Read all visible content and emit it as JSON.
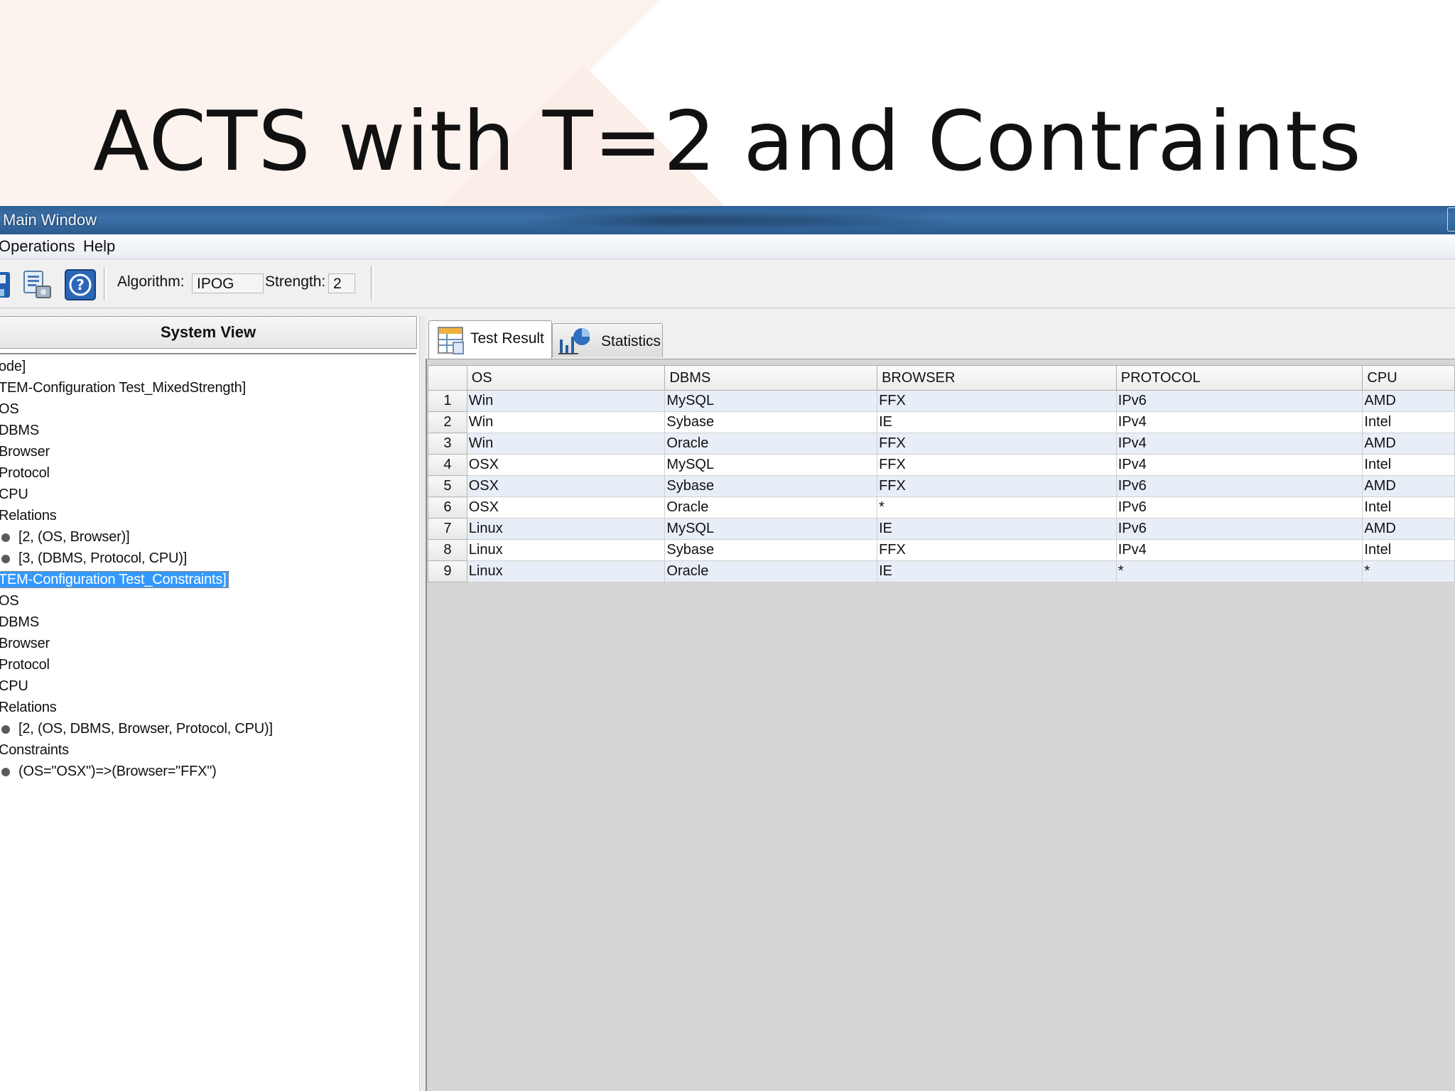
{
  "slide": {
    "title": "ACTS with T=2 and Contraints"
  },
  "window": {
    "title": "Main Window"
  },
  "menu": {
    "items": [
      "Operations",
      "Help"
    ]
  },
  "toolbar": {
    "icons": [
      "save-icon",
      "build-icon",
      "help-icon"
    ],
    "algorithm_label": "Algorithm:",
    "algorithm_value": "IPOG",
    "strength_label": "Strength:",
    "strength_value": "2"
  },
  "system_view": {
    "header": "System View",
    "items": [
      {
        "text": "ode]",
        "bullet": false
      },
      {
        "text": "TEM-Configuration Test_MixedStrength]",
        "bullet": false
      },
      {
        "text": "OS",
        "bullet": false
      },
      {
        "text": "DBMS",
        "bullet": false
      },
      {
        "text": "Browser",
        "bullet": false
      },
      {
        "text": "Protocol",
        "bullet": false
      },
      {
        "text": "CPU",
        "bullet": false
      },
      {
        "text": "Relations",
        "bullet": false
      },
      {
        "text": "[2, (OS, Browser)]",
        "bullet": true
      },
      {
        "text": "[3, (DBMS, Protocol, CPU)]",
        "bullet": true
      },
      {
        "text": "TEM-Configuration Test_Constraints]",
        "bullet": false,
        "selected": true
      },
      {
        "text": "OS",
        "bullet": false
      },
      {
        "text": "DBMS",
        "bullet": false
      },
      {
        "text": "Browser",
        "bullet": false
      },
      {
        "text": "Protocol",
        "bullet": false
      },
      {
        "text": "CPU",
        "bullet": false
      },
      {
        "text": "Relations",
        "bullet": false
      },
      {
        "text": "[2, (OS, DBMS, Browser, Protocol, CPU)]",
        "bullet": true
      },
      {
        "text": "Constraints",
        "bullet": false
      },
      {
        "text": "(OS=\"OSX\")=>(Browser=\"FFX\")",
        "bullet": true
      }
    ]
  },
  "tabs": [
    {
      "label": "Test Result",
      "icon": "table-icon",
      "active": true
    },
    {
      "label": "Statistics",
      "icon": "chart-icon",
      "active": false
    }
  ],
  "results": {
    "columns": [
      "",
      "OS",
      "DBMS",
      "BROWSER",
      "PROTOCOL",
      "CPU"
    ],
    "rows": [
      [
        "1",
        "Win",
        "MySQL",
        "FFX",
        "IPv6",
        "AMD"
      ],
      [
        "2",
        "Win",
        "Sybase",
        "IE",
        "IPv4",
        "Intel"
      ],
      [
        "3",
        "Win",
        "Oracle",
        "FFX",
        "IPv4",
        "AMD"
      ],
      [
        "4",
        "OSX",
        "MySQL",
        "FFX",
        "IPv4",
        "Intel"
      ],
      [
        "5",
        "OSX",
        "Sybase",
        "FFX",
        "IPv6",
        "AMD"
      ],
      [
        "6",
        "OSX",
        "Oracle",
        "*",
        "IPv6",
        "Intel"
      ],
      [
        "7",
        "Linux",
        "MySQL",
        "IE",
        "IPv6",
        "AMD"
      ],
      [
        "8",
        "Linux",
        "Sybase",
        "FFX",
        "IPv4",
        "Intel"
      ],
      [
        "9",
        "Linux",
        "Oracle",
        "IE",
        "*",
        "*"
      ]
    ]
  },
  "colors": {
    "titlebar": "#3d73aa",
    "selection": "#3399ff",
    "row_alt": "#e8eef8",
    "slide_accent": "#fdf0ea"
  }
}
